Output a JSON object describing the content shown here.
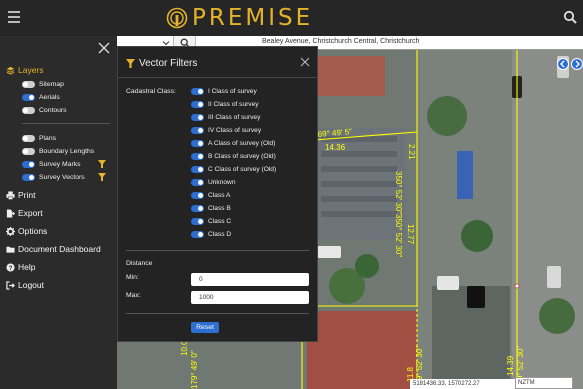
{
  "header": {
    "logo_text": "PREMISE",
    "menu_icon": "hamburger-icon",
    "search_icon": "search-icon"
  },
  "colors": {
    "brand": "#e3b32b",
    "accent": "#2c6fd1",
    "sidebar_bg": "#2b2b2b",
    "header_bg": "#262626",
    "survey_line": "#ffff00"
  },
  "map": {
    "address": "Bealey Avenue, Christchurch Central, Christchurch",
    "coordinates": "5181436.33, 1570272.27",
    "crs": "NZTM",
    "labels": [
      "69° 49' 5\"",
      "14.36",
      "350° 52' 30\"",
      "2.21",
      "350° 52' 30\"",
      "12.77",
      "10.05",
      "179° 49' 0\"",
      "11.8",
      "179° 52' 30\"",
      "14.39",
      "179° 52' 30\""
    ]
  },
  "sidebar": {
    "layers_heading": "Layers",
    "layer_toggles": [
      {
        "label": "Sitemap",
        "on": false
      },
      {
        "label": "Aerials",
        "on": true
      },
      {
        "label": "Contours",
        "on": false
      }
    ],
    "extra_toggles": [
      {
        "label": "Plans",
        "on": false
      },
      {
        "label": "Boundary Lengths",
        "on": false
      },
      {
        "label": "Survey Marks",
        "on": true
      },
      {
        "label": "Survey Vectors",
        "on": true
      }
    ],
    "nav": [
      {
        "label": "Print",
        "icon": "printer-icon"
      },
      {
        "label": "Export",
        "icon": "export-icon"
      },
      {
        "label": "Options",
        "icon": "gear-icon"
      },
      {
        "label": "Document Dashboard",
        "icon": "folder-icon"
      },
      {
        "label": "Help",
        "icon": "help-icon"
      },
      {
        "label": "Logout",
        "icon": "logout-icon"
      }
    ]
  },
  "modal": {
    "title": "Vector Filters",
    "cadastral_label": "Cadastral Class:",
    "classes": [
      "I Class of survey",
      "II Class of survey",
      "III Class of survey",
      "IV Class of survey",
      "A Class of survey (Old)",
      "B Class of survey (Old)",
      "C Class of survey (Old)",
      "Unknown",
      "Class A",
      "Class B",
      "Class C",
      "Class D"
    ],
    "distance_label": "Distance",
    "min_label": "Min:",
    "min_value": "0",
    "max_label": "Max:",
    "max_value": "1000",
    "reset_label": "Reset"
  }
}
